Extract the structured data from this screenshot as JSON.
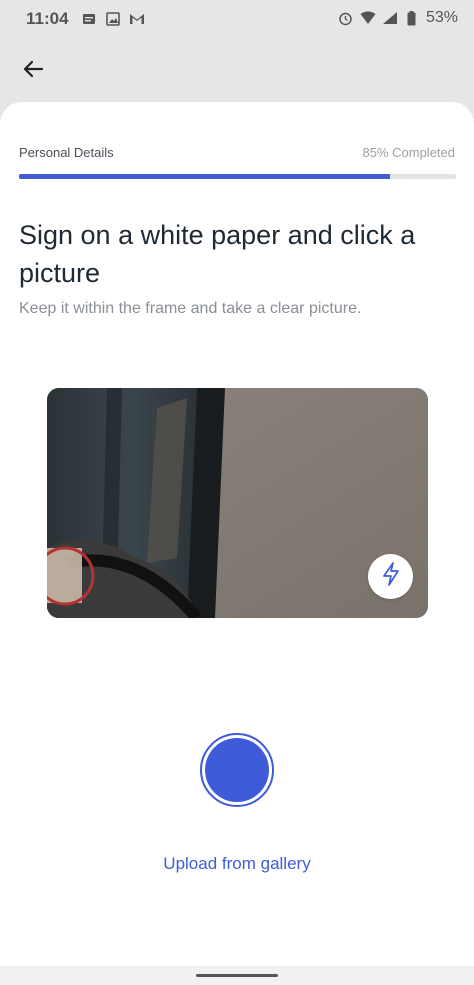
{
  "status_bar": {
    "time": "11:04",
    "battery": "53%",
    "left_icons": [
      "message-icon",
      "image-icon",
      "gmail-icon"
    ],
    "right_icons": [
      "alarm-icon",
      "wifi-icon",
      "signal-icon",
      "battery-icon"
    ]
  },
  "header": {
    "back_icon": "arrow-left-icon"
  },
  "progress": {
    "label": "Personal Details",
    "percent_text": "85% Completed",
    "value": 0.85,
    "fill_color": "#3f5bd8"
  },
  "main": {
    "title": "Sign on a white paper and click a picture",
    "subtitle": "Keep it within the frame and take a clear picture."
  },
  "camera": {
    "flash_icon": "flash-icon"
  },
  "actions": {
    "upload_label": "Upload from gallery"
  },
  "colors": {
    "accent": "#3f5bd8"
  }
}
